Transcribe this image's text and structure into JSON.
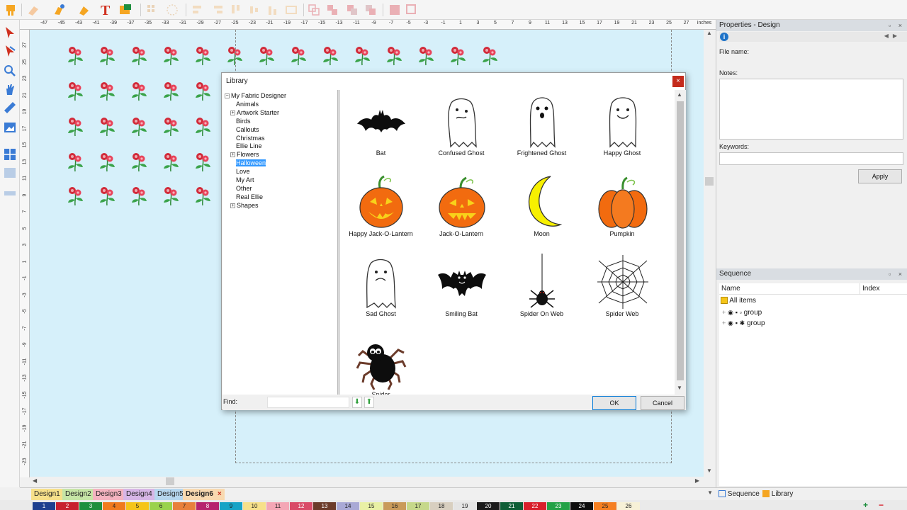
{
  "ruler": {
    "h_ticks": [
      "-47",
      "-45",
      "-43",
      "-41",
      "-39",
      "-37",
      "-35",
      "-33",
      "-31",
      "-29",
      "-27",
      "-25",
      "-23",
      "-21",
      "-19",
      "-17",
      "-15",
      "-13",
      "-11",
      "-9",
      "-7",
      "-5",
      "-3",
      "-1",
      "1",
      "3",
      "5",
      "7",
      "9",
      "11",
      "13",
      "15",
      "17",
      "19",
      "21",
      "23",
      "25",
      "27"
    ],
    "units": "inches",
    "v_ticks": [
      "27",
      "25",
      "23",
      "21",
      "19",
      "17",
      "15",
      "13",
      "11",
      "9",
      "7",
      "5",
      "3",
      "1",
      "-1",
      "-3",
      "-5",
      "-7",
      "-9",
      "-11",
      "-13",
      "-15",
      "-17",
      "-19",
      "-21",
      "-23"
    ]
  },
  "properties": {
    "title": "Properties - Design",
    "file_name_label": "File name:",
    "notes_label": "Notes:",
    "keywords_label": "Keywords:",
    "apply_label": "Apply"
  },
  "sequence": {
    "title": "Sequence",
    "col_name": "Name",
    "col_index": "Index",
    "all_items": "All items",
    "rows": [
      "group",
      "group"
    ]
  },
  "design_tabs": [
    "Design1",
    "Design2",
    "Design3",
    "Design4",
    "Design5",
    "Design6"
  ],
  "active_design": "Design6",
  "panel_tabs": {
    "sequence": "Sequence",
    "library": "Library"
  },
  "palette": [
    {
      "n": "1",
      "c": "#1d3f8f"
    },
    {
      "n": "2",
      "c": "#c8202f"
    },
    {
      "n": "3",
      "c": "#1e8f3e"
    },
    {
      "n": "4",
      "c": "#f07b1d"
    },
    {
      "n": "5",
      "c": "#f5c518"
    },
    {
      "n": "6",
      "c": "#9ad24b"
    },
    {
      "n": "7",
      "c": "#e8803c"
    },
    {
      "n": "8",
      "c": "#b6246e"
    },
    {
      "n": "9",
      "c": "#17a3c6"
    },
    {
      "n": "10",
      "c": "#f7e08a"
    },
    {
      "n": "11",
      "c": "#f4a6b5"
    },
    {
      "n": "12",
      "c": "#d94a67"
    },
    {
      "n": "13",
      "c": "#6b3b2a"
    },
    {
      "n": "14",
      "c": "#a9a9d6"
    },
    {
      "n": "15",
      "c": "#e9f0a5"
    },
    {
      "n": "16",
      "c": "#c99a5a"
    },
    {
      "n": "17",
      "c": "#c6d88a"
    },
    {
      "n": "18",
      "c": "#d8cfc0"
    },
    {
      "n": "19",
      "c": "#e4e4e4"
    },
    {
      "n": "20",
      "c": "#1a1a1a"
    },
    {
      "n": "21",
      "c": "#0e5e36"
    },
    {
      "n": "22",
      "c": "#d81f2a"
    },
    {
      "n": "23",
      "c": "#23a146"
    },
    {
      "n": "24",
      "c": "#0d0d0d"
    },
    {
      "n": "25",
      "c": "#f57f20"
    },
    {
      "n": "26",
      "c": "#f7f1d7"
    }
  ],
  "library": {
    "title": "Library",
    "close": "×",
    "tree": [
      {
        "label": "My Fabric Designer",
        "level": 0,
        "expander": "−"
      },
      {
        "label": "Animals",
        "level": 1
      },
      {
        "label": "Artwork Starter",
        "level": 1,
        "expander": "+"
      },
      {
        "label": "Birds",
        "level": 1
      },
      {
        "label": "Callouts",
        "level": 1
      },
      {
        "label": "Christmas",
        "level": 1
      },
      {
        "label": "Ellie Line",
        "level": 1
      },
      {
        "label": "Flowers",
        "level": 1,
        "expander": "+"
      },
      {
        "label": "Halloween",
        "level": 1,
        "selected": true
      },
      {
        "label": "Love",
        "level": 1
      },
      {
        "label": "My Art",
        "level": 1
      },
      {
        "label": "Other",
        "level": 1
      },
      {
        "label": "Real Ellie",
        "level": 1
      },
      {
        "label": "Shapes",
        "level": 1,
        "expander": "+"
      }
    ],
    "items": [
      {
        "label": "Bat",
        "icon": "bat-icon"
      },
      {
        "label": "Confused Ghost",
        "icon": "confused-ghost-icon"
      },
      {
        "label": "Frightened Ghost",
        "icon": "frightened-ghost-icon"
      },
      {
        "label": "Happy Ghost",
        "icon": "happy-ghost-icon"
      },
      {
        "label": "Happy Jack-O-Lantern",
        "icon": "happy-jack-o-lantern-icon"
      },
      {
        "label": "Jack-O-Lantern",
        "icon": "jack-o-lantern-icon"
      },
      {
        "label": "Moon",
        "icon": "moon-icon"
      },
      {
        "label": "Pumpkin",
        "icon": "pumpkin-icon"
      },
      {
        "label": "Sad Ghost",
        "icon": "sad-ghost-icon"
      },
      {
        "label": "Smiling Bat",
        "icon": "smiling-bat-icon"
      },
      {
        "label": "Spider On Web",
        "icon": "spider-on-web-icon"
      },
      {
        "label": "Spider Web",
        "icon": "spider-web-icon"
      },
      {
        "label": "Spider",
        "icon": "spider-icon"
      }
    ],
    "find_label": "Find:",
    "find_value": "",
    "ok_label": "OK",
    "cancel_label": "Cancel"
  }
}
